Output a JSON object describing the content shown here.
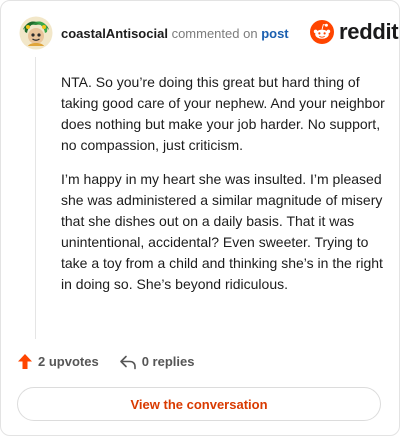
{
  "comment": {
    "username": "coastalAntisocial",
    "action_text": "commented on",
    "post_link": "post",
    "paragraphs": [
      "NTA. So you’re doing this great but hard thing of taking good care of your nephew. And your neighbor does nothing but make your job harder. No support, no compassion, just criticism.",
      "I’m happy in my heart she was insulted. I’m pleased she was administered a similar magnitude of misery that she dishes out on a daily basis. That it was unintentional, accidental? Even sweeter. Trying to take a toy from a child and thinking she’s in the right in doing so. She’s beyond ridiculous."
    ]
  },
  "brand": {
    "wordmark": "reddit",
    "icon": "reddit-snoo-icon",
    "color": "#ff4500"
  },
  "stats": {
    "upvotes": "2 upvotes",
    "replies": "0 replies",
    "upvote_icon": "upvote-arrow-icon",
    "upvote_color": "#ff4500",
    "reply_icon": "reply-arrow-icon"
  },
  "cta": {
    "label": "View the conversation",
    "color": "#d93a00"
  }
}
